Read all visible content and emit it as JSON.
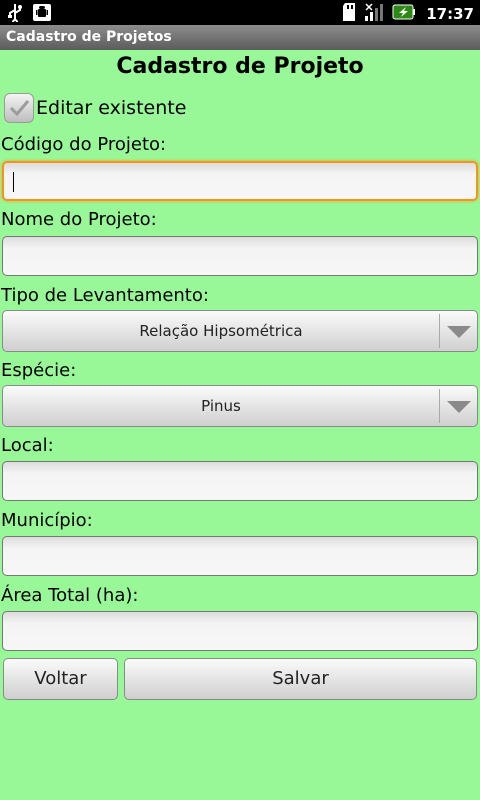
{
  "status_bar": {
    "time": "17:37",
    "left_icons": [
      "usb-icon",
      "android-debug-icon"
    ],
    "right_icons": [
      "sd-card-icon",
      "signal-icon",
      "battery-charging-icon"
    ]
  },
  "app": {
    "title": "Cadastro de Projetos"
  },
  "form": {
    "heading": "Cadastro de Projeto",
    "edit_existing": {
      "label": "Editar existente",
      "checked": true
    },
    "codigo": {
      "label": "Código do Projeto:",
      "value": ""
    },
    "nome": {
      "label": "Nome do Projeto:",
      "value": ""
    },
    "tipo": {
      "label": "Tipo de Levantamento:",
      "selected": "Relação Hipsométrica"
    },
    "especie": {
      "label": "Espécie:",
      "selected": "Pinus"
    },
    "local": {
      "label": "Local:",
      "value": ""
    },
    "municipio": {
      "label": "Município:",
      "value": ""
    },
    "area": {
      "label": "Área Total (ha):",
      "value": ""
    }
  },
  "buttons": {
    "back": "Voltar",
    "save": "Salvar"
  },
  "colors": {
    "background": "#98f898",
    "focus": "#f7931e"
  }
}
